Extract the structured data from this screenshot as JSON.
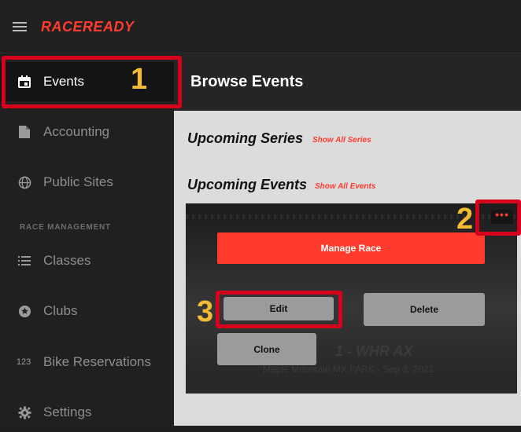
{
  "app": {
    "logo_part1": "RACE",
    "logo_part2": "READY",
    "accent_color": "#ff3b2e",
    "highlight_color": "#d6001c",
    "annotation_color": "#f2bb32"
  },
  "sidebar": {
    "items": [
      {
        "label": "Events",
        "icon": "calendar-icon",
        "active": true
      },
      {
        "label": "Accounting",
        "icon": "document-icon"
      },
      {
        "label": "Public Sites",
        "icon": "globe-icon"
      },
      {
        "label": "Classes",
        "icon": "list-icon"
      },
      {
        "label": "Clubs",
        "icon": "star-badge-icon"
      },
      {
        "label": "Bike Reservations",
        "icon": "numbers-icon",
        "icon_text": "123"
      },
      {
        "label": "Settings",
        "icon": "gear-icon"
      }
    ],
    "section_label": "RACE MANAGEMENT"
  },
  "header": {
    "title": "Browse Events"
  },
  "main": {
    "upcoming_series": {
      "title": "Upcoming Series",
      "link": "Show All Series"
    },
    "upcoming_events": {
      "title": "Upcoming Events",
      "link": "Show All Events"
    },
    "event_card": {
      "title_partial": "1 - WHR AX",
      "subtitle": "Maple Mountain MX PARK - Sep 3, 2022",
      "menu_label": "•••",
      "manage_label": "Manage Race",
      "edit_label": "Edit",
      "delete_label": "Delete",
      "clone_label": "Clone"
    }
  },
  "annotations": {
    "step1": "1",
    "step2": "2",
    "step3": "3"
  }
}
